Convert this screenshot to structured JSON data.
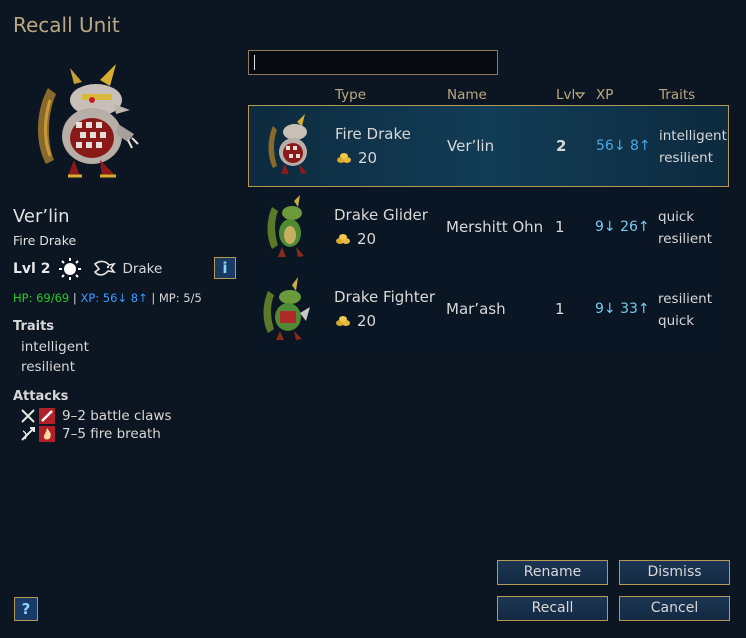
{
  "dialog": {
    "title": "Recall Unit"
  },
  "selected_unit": {
    "name": "Ver’lin",
    "type": "Fire Drake",
    "level": "Lvl 2",
    "race": "Drake",
    "hp_label": "HP: 69/69",
    "xp_label": "XP: 56↓ 8↑",
    "mp_label": "MP: 5/5",
    "separator": " | ",
    "traits_heading": "Traits",
    "traits": [
      "intelligent",
      "resilient"
    ],
    "attacks_heading": "Attacks",
    "attacks": [
      {
        "text": "9–2 battle claws",
        "range_icon": "melee-icon",
        "type_icon": "blade-icon"
      },
      {
        "text": "7–5 fire breath",
        "range_icon": "ranged-icon",
        "type_icon": "fire-icon"
      }
    ]
  },
  "search": {
    "value": "",
    "placeholder": ""
  },
  "table": {
    "headers": {
      "type": "Type",
      "name": "Name",
      "level": "Lvl",
      "xp": "XP",
      "traits": "Traits"
    },
    "rows": [
      {
        "type": "Fire Drake",
        "cost": "20",
        "name": "Ver’lin",
        "level": "2",
        "xp": "56↓ 8↑",
        "trait1": "intelligent",
        "trait2": "resilient",
        "selected": true
      },
      {
        "type": "Drake Glider",
        "cost": "20",
        "name": "Mershitt Ohn",
        "level": "1",
        "xp": "9↓ 26↑",
        "trait1": "quick",
        "trait2": "resilient",
        "selected": false
      },
      {
        "type": "Drake Fighter",
        "cost": "20",
        "name": "Mar’ash",
        "level": "1",
        "xp": "9↓ 33↑",
        "trait1": "resilient",
        "trait2": "quick",
        "selected": false
      }
    ]
  },
  "buttons": {
    "rename": "Rename",
    "dismiss": "Dismiss",
    "recall": "Recall",
    "cancel": "Cancel",
    "help": "?",
    "info": "i"
  },
  "colors": {
    "title": "#bca880",
    "hp": "#22cc22",
    "xp": "#3a9bff",
    "border_gold": "#b59a56",
    "background": "#0c1522"
  }
}
